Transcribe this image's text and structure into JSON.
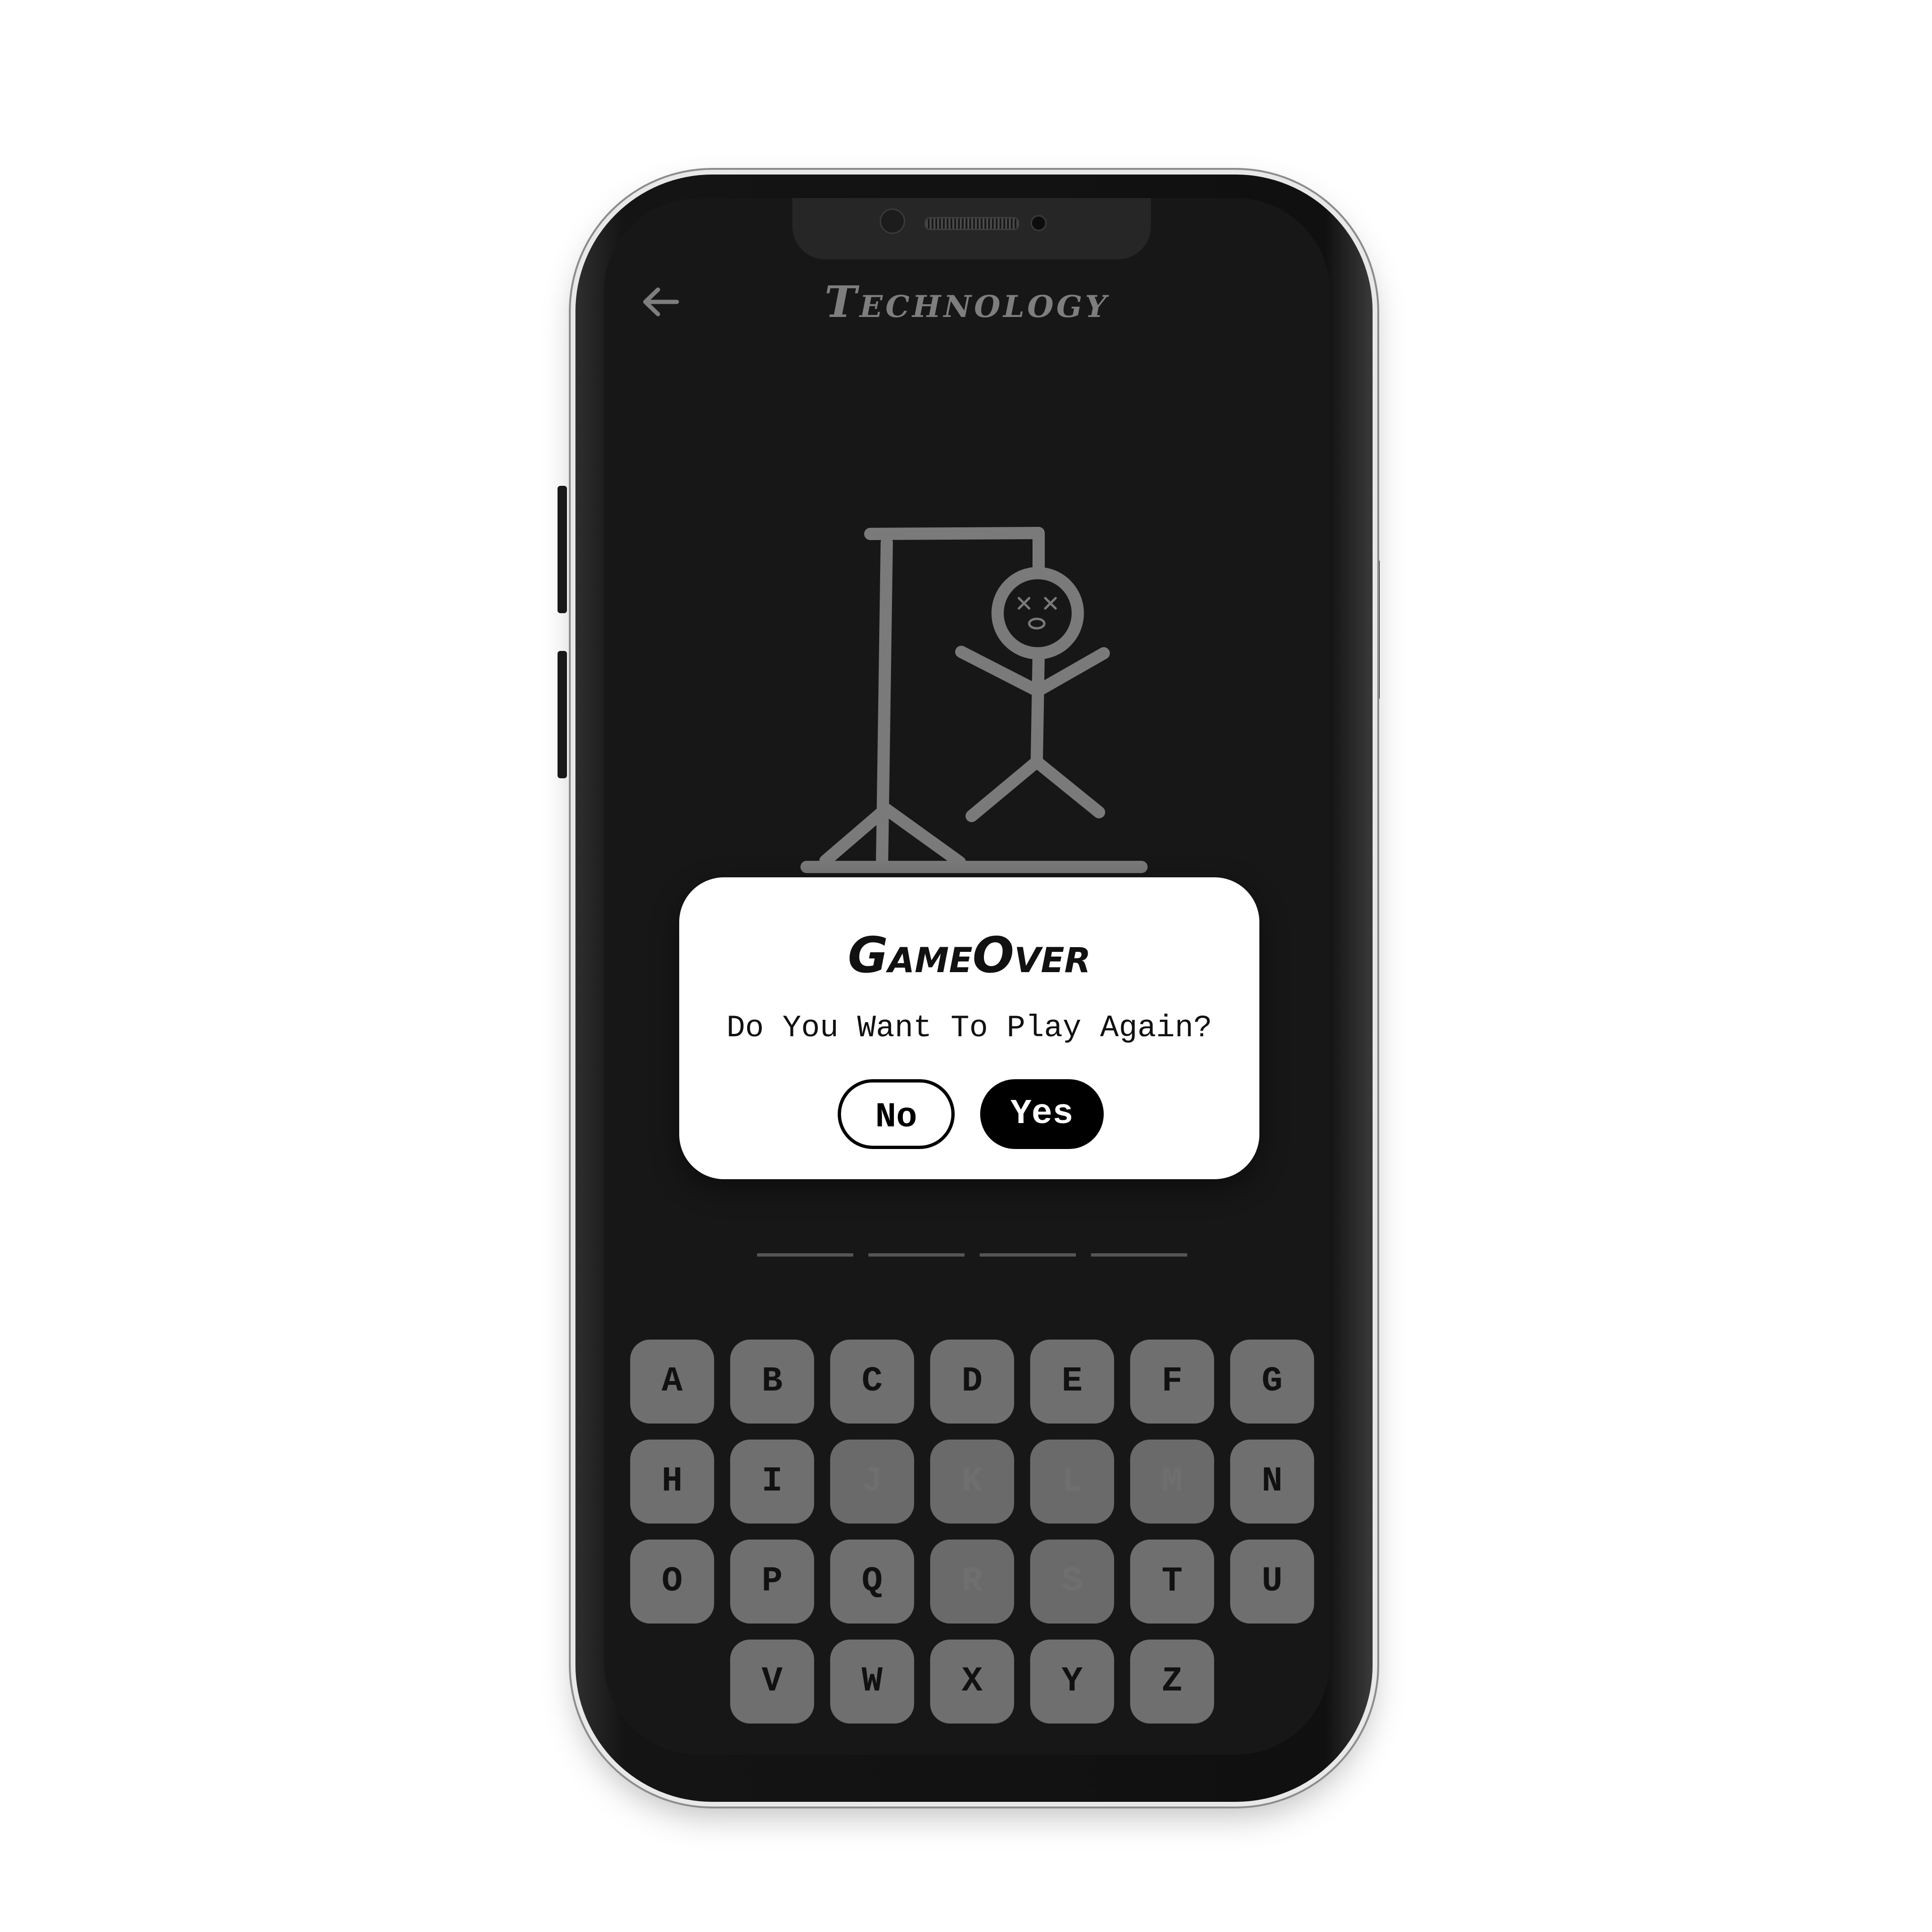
{
  "header": {
    "back_icon": "arrow-left-icon",
    "title": "Technology"
  },
  "colors": {
    "screen_background": "#171717",
    "drawing": "#7a7a7a",
    "title": "#7e7e7e",
    "key_background": "#6f6f6f",
    "dialog_background": "#ffffff",
    "yes_button": "#000000"
  },
  "game": {
    "word_length": 4,
    "wrong_guess_stage": "complete",
    "face": "dead"
  },
  "dialog": {
    "title": "GameOver",
    "message": "Do You Want To Play Again?",
    "no_label": "No",
    "yes_label": "Yes"
  },
  "keyboard": {
    "keys": [
      {
        "letter": "A",
        "used": false
      },
      {
        "letter": "B",
        "used": false
      },
      {
        "letter": "C",
        "used": false
      },
      {
        "letter": "D",
        "used": false
      },
      {
        "letter": "E",
        "used": false
      },
      {
        "letter": "F",
        "used": false
      },
      {
        "letter": "G",
        "used": false
      },
      {
        "letter": "H",
        "used": false
      },
      {
        "letter": "I",
        "used": false
      },
      {
        "letter": "J",
        "used": true
      },
      {
        "letter": "K",
        "used": true
      },
      {
        "letter": "L",
        "used": true
      },
      {
        "letter": "M",
        "used": true
      },
      {
        "letter": "N",
        "used": false
      },
      {
        "letter": "O",
        "used": false
      },
      {
        "letter": "P",
        "used": false
      },
      {
        "letter": "Q",
        "used": false
      },
      {
        "letter": "R",
        "used": true
      },
      {
        "letter": "S",
        "used": true
      },
      {
        "letter": "T",
        "used": false
      },
      {
        "letter": "U",
        "used": false
      },
      {
        "letter": "V",
        "used": false
      },
      {
        "letter": "W",
        "used": false
      },
      {
        "letter": "X",
        "used": false
      },
      {
        "letter": "Y",
        "used": false
      },
      {
        "letter": "Z",
        "used": false
      }
    ]
  }
}
